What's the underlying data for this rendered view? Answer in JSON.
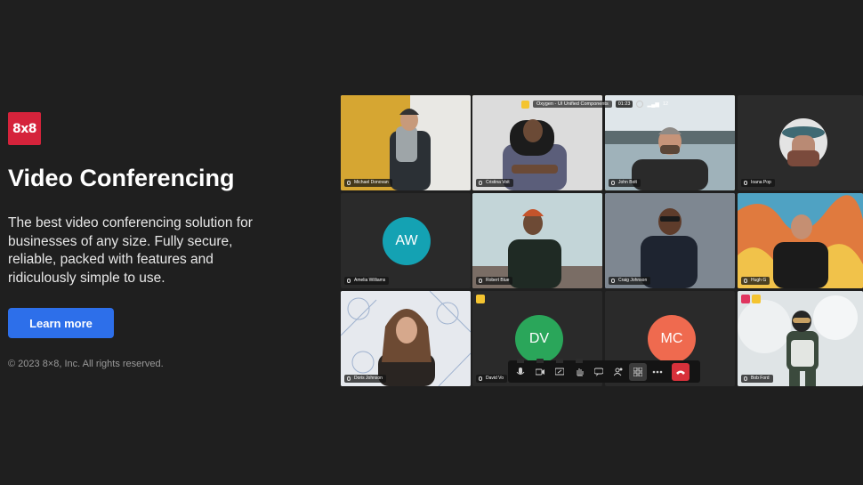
{
  "brand": {
    "logo_text": "8x8",
    "color": "#d5233b"
  },
  "hero": {
    "title": "Video Conferencing",
    "description": "The best video conferencing solution for businesses of any size. Fully secure, reliable, packed with features and ridiculously simple to use.",
    "cta_label": "Learn more",
    "copyright": "© 2023 8×8, Inc. All rights reserved."
  },
  "meeting": {
    "room_name": "Oxygen - UI Unified Components",
    "timer": "01:23",
    "participant_count": "12",
    "participants": [
      {
        "name": "Michael Donovan",
        "kind": "photo",
        "tone": "#d4a52f"
      },
      {
        "name": "Cristina Voit",
        "kind": "photo",
        "tone": "#d9d9d9"
      },
      {
        "name": "John Bolt",
        "kind": "photo",
        "tone": "#b7c7cf"
      },
      {
        "name": "Ioana Pop",
        "kind": "avatar-photo",
        "tone": "#2b2b2b"
      },
      {
        "name": "Amelia Williams",
        "kind": "initials",
        "initials": "AW",
        "color": "#14a2b3"
      },
      {
        "name": "Robert Blue",
        "kind": "photo",
        "tone": "#b9cfd3"
      },
      {
        "name": "Craig Johnson",
        "kind": "photo",
        "tone": "#7e8791"
      },
      {
        "name": "Hugh G",
        "kind": "photo",
        "tone": "#e07a3e"
      },
      {
        "name": "Doris Johnson",
        "kind": "photo",
        "tone": "#e6e9ee"
      },
      {
        "name": "David Vo",
        "kind": "initials",
        "initials": "DV",
        "color": "#2aa65a"
      },
      {
        "name": "",
        "kind": "initials",
        "initials": "MC",
        "color": "#ef6a4f"
      },
      {
        "name": "Bob Ford",
        "kind": "photo",
        "tone": "#dfe4e6"
      }
    ]
  }
}
